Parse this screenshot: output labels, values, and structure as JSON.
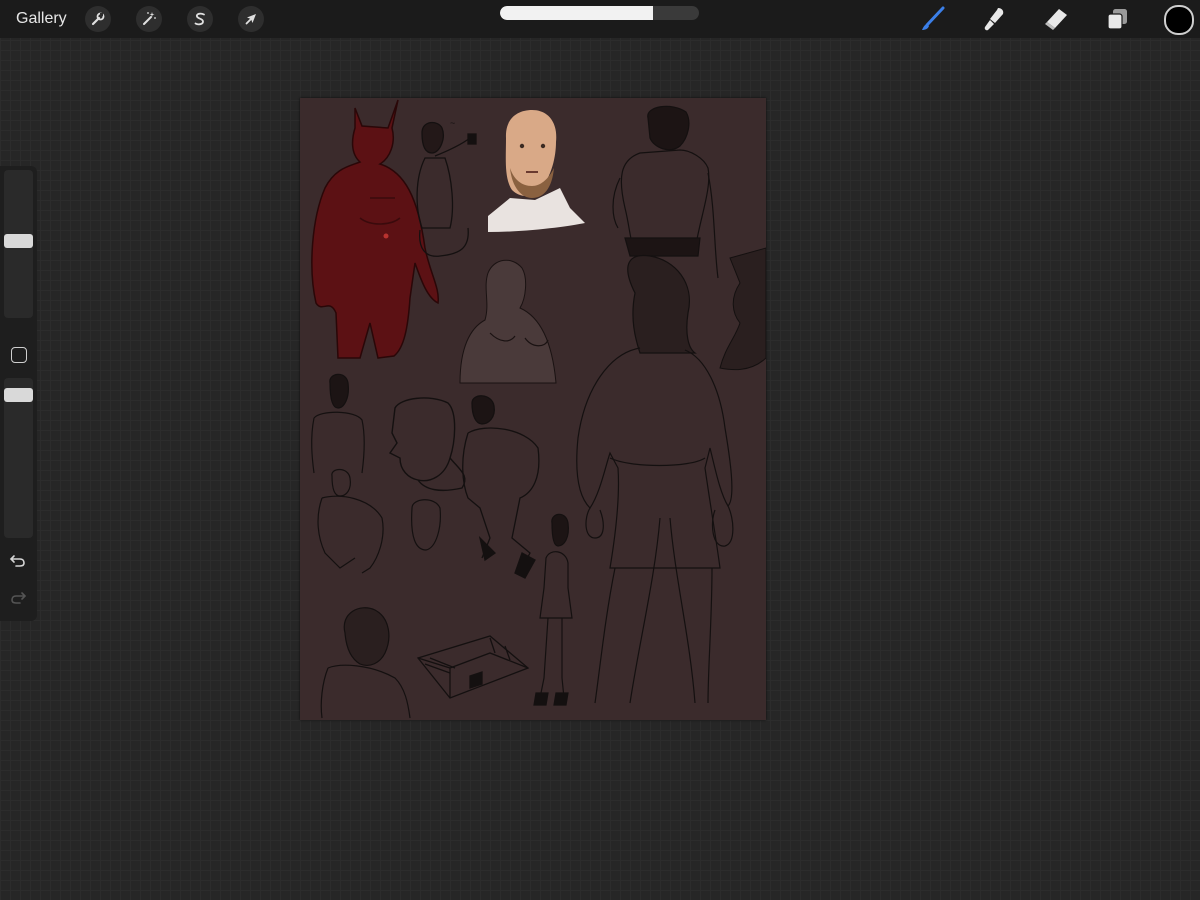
{
  "topbar": {
    "gallery_label": "Gallery",
    "left_tools": [
      {
        "icon": "wrench-icon",
        "name": "actions"
      },
      {
        "icon": "magic-wand-icon",
        "name": "adjustments"
      },
      {
        "icon": "selection-s-icon",
        "name": "selection"
      },
      {
        "icon": "arrow-cursor-icon",
        "name": "transform"
      }
    ],
    "progress_fraction": 0.77,
    "right_tools": [
      {
        "icon": "brush-icon",
        "name": "paint",
        "active": true
      },
      {
        "icon": "smudge-icon",
        "name": "smudge"
      },
      {
        "icon": "eraser-icon",
        "name": "erase"
      },
      {
        "icon": "layers-icon",
        "name": "layers"
      }
    ],
    "current_color": "#000000"
  },
  "sidebar": {
    "brush_size_level": 0.52,
    "opacity_level": 0.93,
    "undo_icon": "undo-icon",
    "redo_icon": "redo-icon",
    "modify_icon": "square-modify-icon"
  },
  "canvas": {
    "background_color": "#3b2b2c",
    "accent_colors": {
      "figure_red": "#5c1114",
      "ink": "#141010",
      "skin": "#d9a987"
    }
  }
}
